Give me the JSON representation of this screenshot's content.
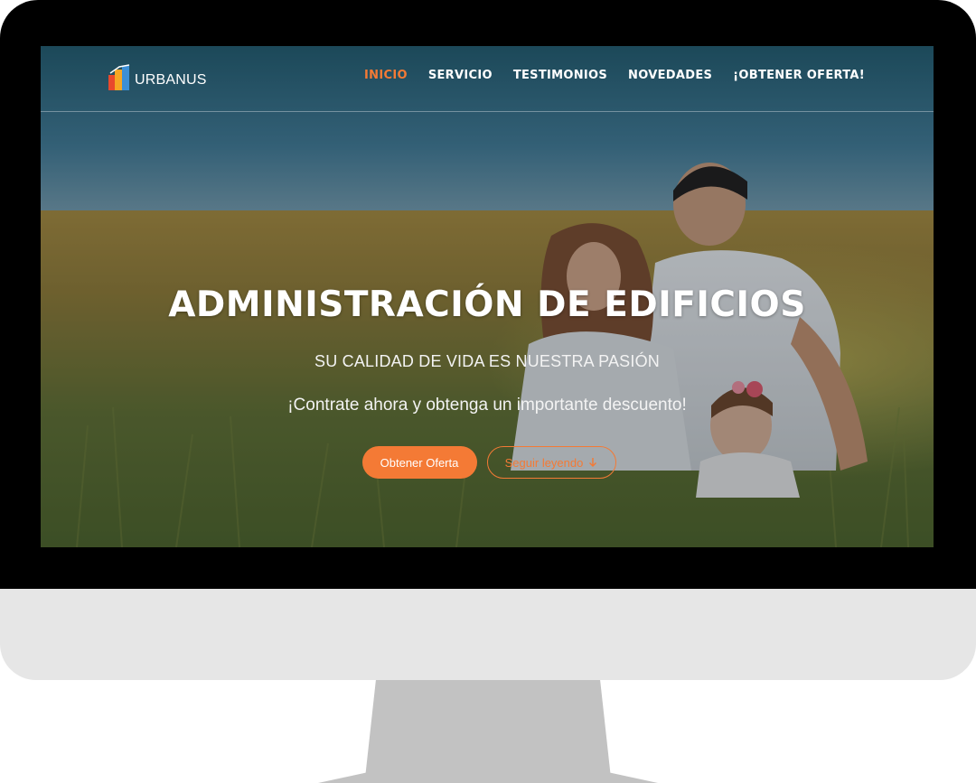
{
  "brand": {
    "name": "URBANUS",
    "accent_color": "#f47a35"
  },
  "nav": {
    "items": [
      {
        "label": "INICIO",
        "active": true
      },
      {
        "label": "SERVICIO",
        "active": false
      },
      {
        "label": "TESTIMONIOS",
        "active": false
      },
      {
        "label": "NOVEDADES",
        "active": false
      },
      {
        "label": "¡OBTENER OFERTA!",
        "active": false
      }
    ]
  },
  "hero": {
    "title": "ADMINISTRACIÓN DE EDIFICIOS",
    "subtitle": "SU CALIDAD DE VIDA ES NUESTRA PASIÓN",
    "cta_text": "¡Contrate ahora y obtenga un importante descuento!",
    "primary_button": "Obtener Oferta",
    "secondary_button": "Seguir leyendo",
    "secondary_icon": "arrow-down-icon",
    "background_image": "family-in-grass-field-photo"
  }
}
